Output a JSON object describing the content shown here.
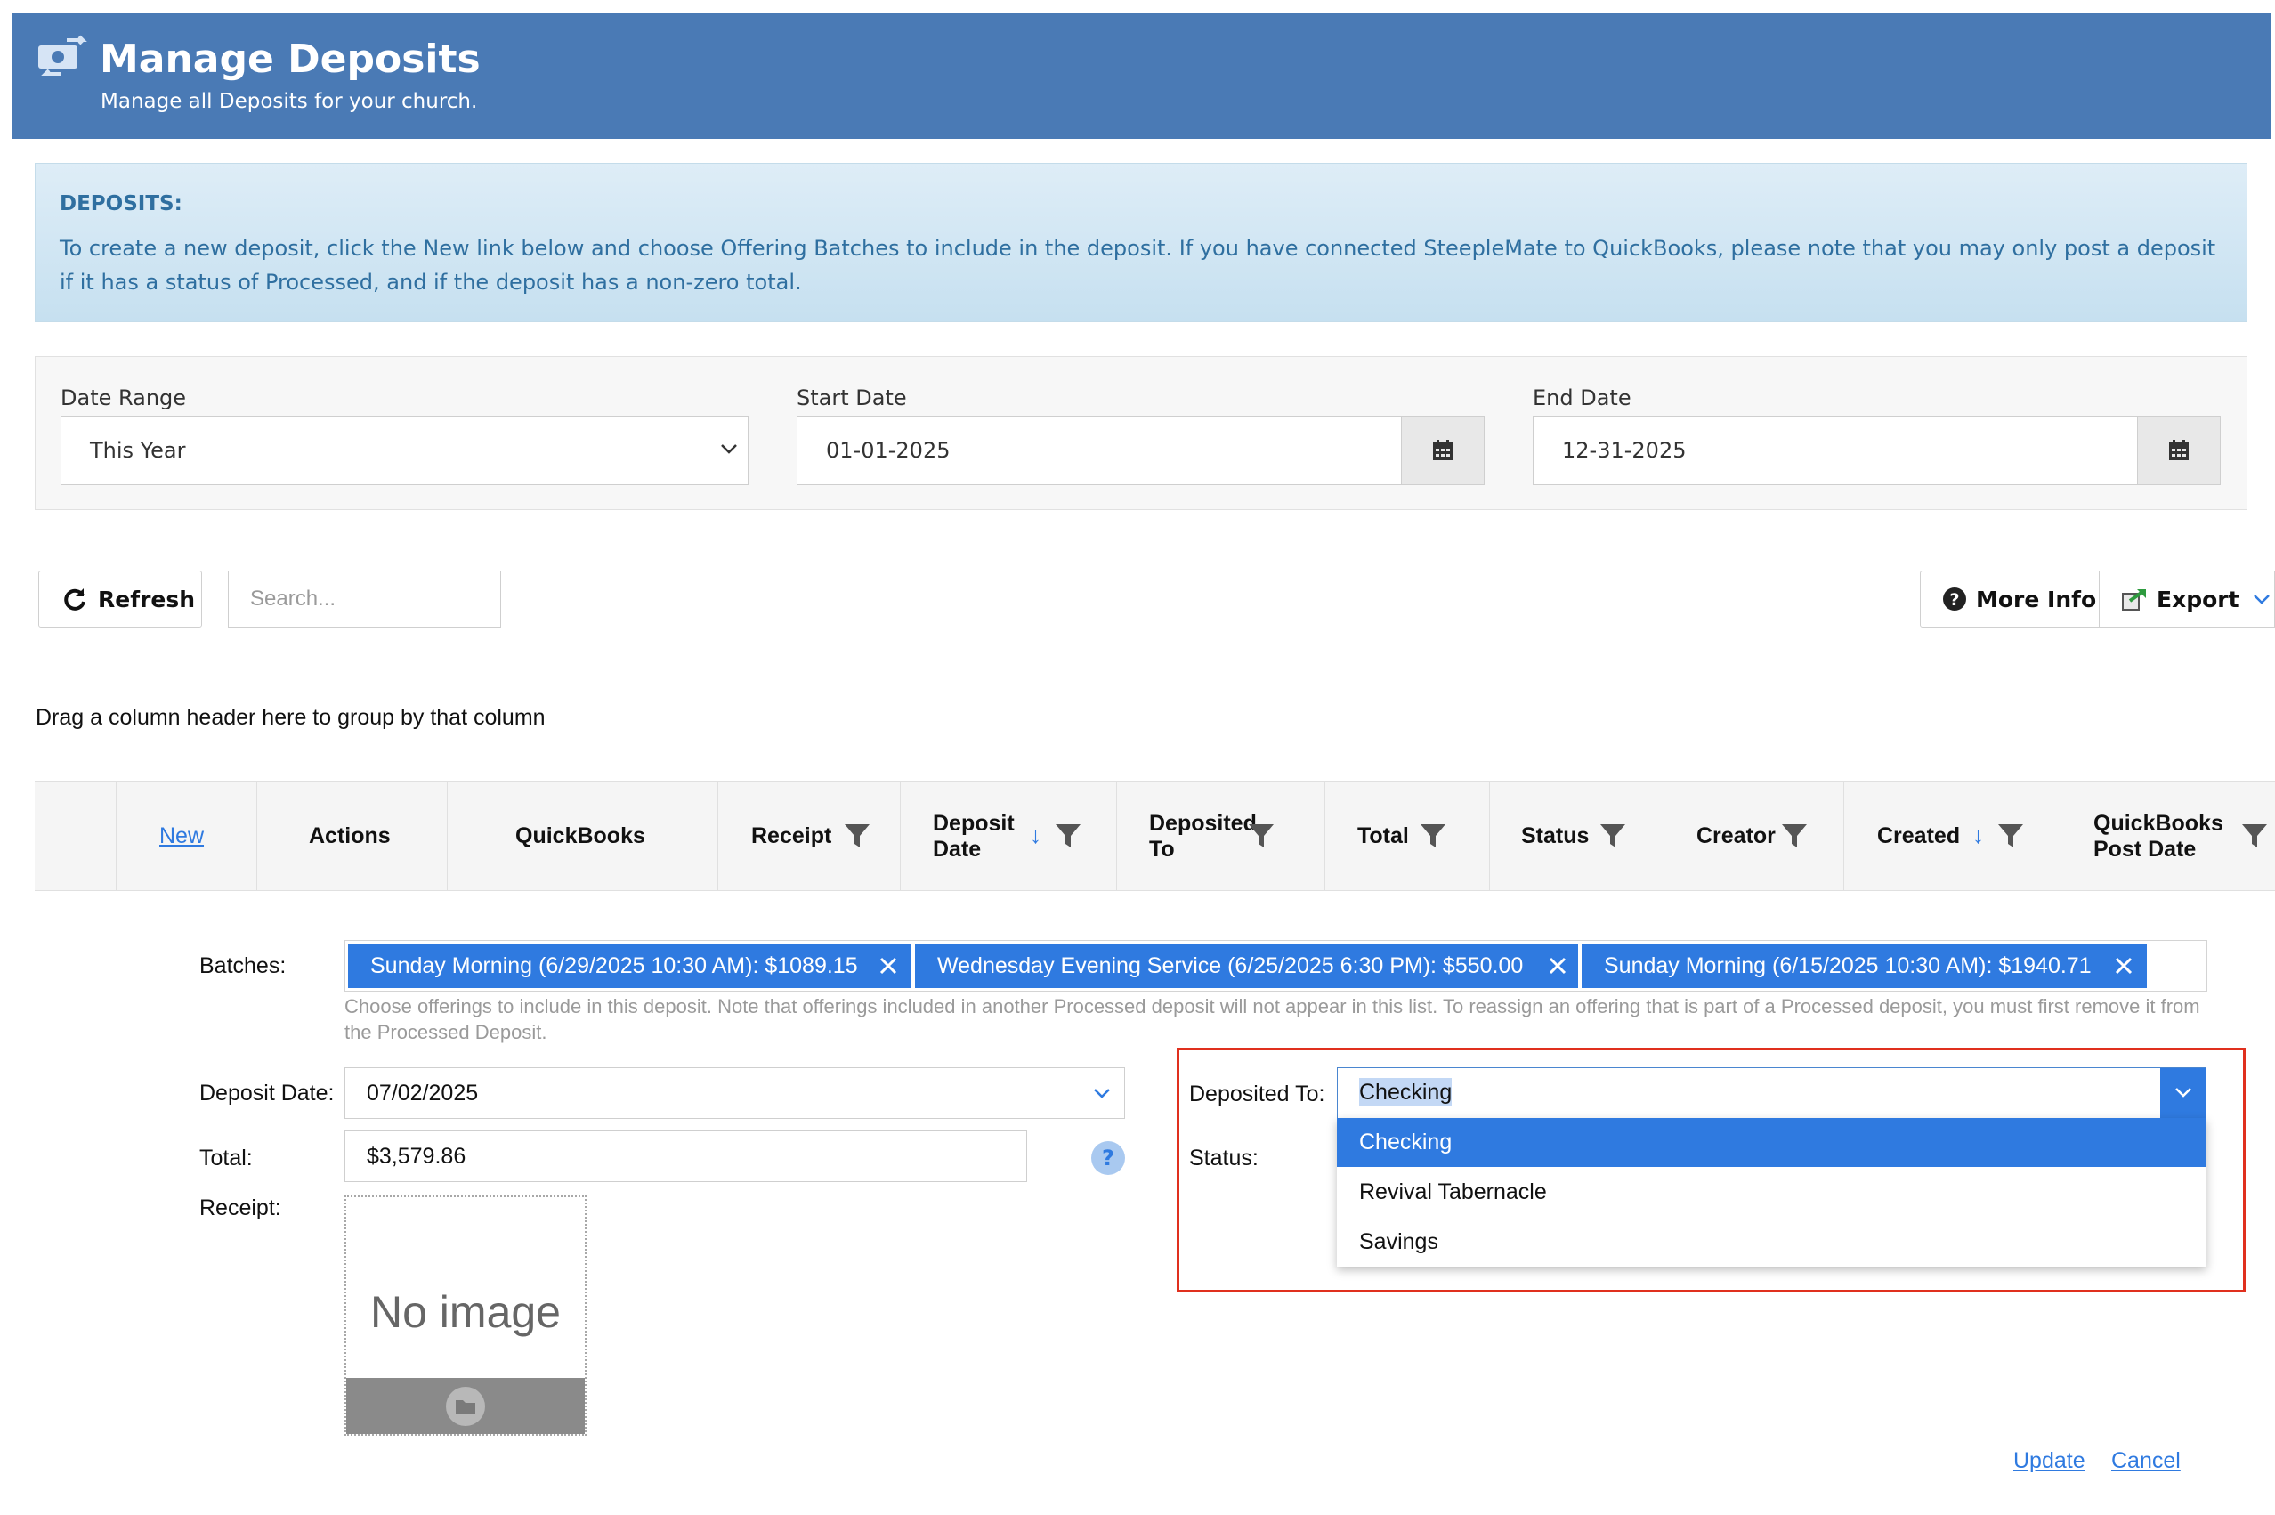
{
  "header": {
    "title": "Manage Deposits",
    "subtitle": "Manage all Deposits for your church.",
    "icon": "money-transfer-icon"
  },
  "info": {
    "heading": "DEPOSITS:",
    "text": "To create a new deposit, click the New link below and choose Offering Batches to include in the deposit. If you have connected SteepleMate to QuickBooks, please note that you may only post a deposit if it has a status of Processed, and if the deposit has a non-zero total."
  },
  "filters": {
    "date_range_label": "Date Range",
    "date_range_value": "This Year",
    "start_date_label": "Start Date",
    "start_date_value": "01-01-2025",
    "end_date_label": "End Date",
    "end_date_value": "12-31-2025"
  },
  "toolbar": {
    "refresh_label": "Refresh",
    "search_placeholder": "Search...",
    "more_info_label": "More Info",
    "export_label": "Export"
  },
  "grid": {
    "group_hint": "Drag a column header here to group by that column",
    "new_link": "New",
    "columns": {
      "actions": "Actions",
      "quickbooks": "QuickBooks",
      "receipt": "Receipt",
      "deposit_date_1": "Deposit",
      "deposit_date_2": "Date",
      "deposited_to_1": "Deposited",
      "deposited_to_2": "To",
      "total": "Total",
      "status": "Status",
      "creator": "Creator",
      "created": "Created",
      "qb_post_date_1": "QuickBooks",
      "qb_post_date_2": "Post Date"
    }
  },
  "form": {
    "batches_label": "Batches:",
    "batches": [
      "Sunday Morning (6/29/2025 10:30 AM): $1089.15",
      "Wednesday Evening Service (6/25/2025 6:30 PM): $550.00",
      "Sunday Morning (6/15/2025 10:30 AM): $1940.71"
    ],
    "batches_help": "Choose offerings to include in this deposit. Note that offerings included in another Processed deposit will not appear in this list. To reassign an offering that is part of a Processed deposit, you must first remove it from the Processed Deposit.",
    "deposit_date_label": "Deposit Date:",
    "deposit_date_value": "07/02/2025",
    "total_label": "Total:",
    "total_value": "$3,579.86",
    "help_glyph": "?",
    "receipt_label": "Receipt:",
    "no_image": "No image",
    "deposited_to_label": "Deposited To:",
    "deposited_to_value": "Checking",
    "status_label": "Status:",
    "deposited_to_options": [
      "Checking",
      "Revival Tabernacle",
      "Savings"
    ],
    "update_link": "Update",
    "cancel_link": "Cancel"
  },
  "colors": {
    "header_bg": "#4a7ab5",
    "accent": "#2f7ae0",
    "highlight": "#e0301e"
  }
}
